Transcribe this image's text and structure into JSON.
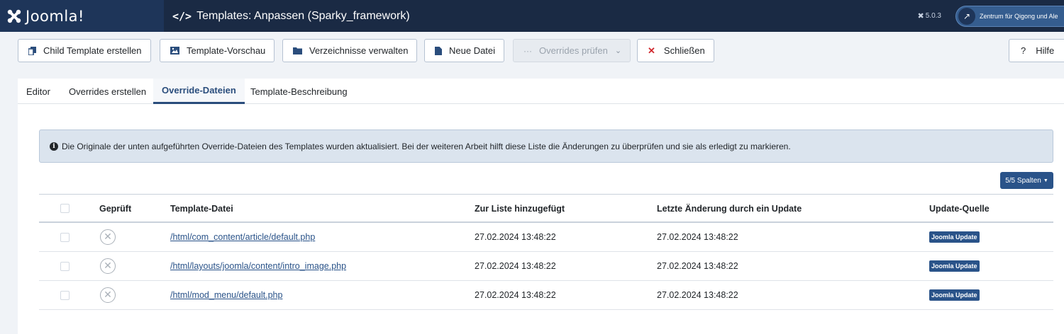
{
  "header": {
    "logo_text": "Joomla!",
    "title": "Templates: Anpassen (Sparky_framework)",
    "version": "5.0.3",
    "site_name": "Zentrum für Qigong und Ale"
  },
  "toolbar": {
    "child_template": "Child Template erstellen",
    "preview": "Template-Vorschau",
    "manage_folders": "Verzeichnisse verwalten",
    "new_file": "Neue Datei",
    "check_overrides": "Overrides prüfen",
    "close": "Schließen",
    "help": "Hilfe"
  },
  "tabs": [
    {
      "label": "Editor"
    },
    {
      "label": "Overrides erstellen"
    },
    {
      "label": "Override-Dateien"
    },
    {
      "label": "Template-Beschreibung"
    }
  ],
  "alert": {
    "text": "Die Originale der unten aufgeführten Override-Dateien des Templates wurden aktualisiert. Bei der weiteren Arbeit hilft diese Liste die Änderungen zu überprüfen und sie als erledigt zu markieren."
  },
  "columns_button": "5/5 Spalten",
  "table": {
    "headers": {
      "checked": "Geprüft",
      "file": "Template-Datei",
      "added": "Zur Liste hinzugefügt",
      "modified": "Letzte Änderung durch ein Update",
      "source": "Update-Quelle"
    },
    "rows": [
      {
        "file": "/html/com_content/article/default.php",
        "added": "27.02.2024 13:48:22",
        "modified": "27.02.2024 13:48:22",
        "source": "Joomla Update"
      },
      {
        "file": "/html/layouts/joomla/content/intro_image.php",
        "added": "27.02.2024 13:48:22",
        "modified": "27.02.2024 13:48:22",
        "source": "Joomla Update"
      },
      {
        "file": "/html/mod_menu/default.php",
        "added": "27.02.2024 13:48:22",
        "modified": "27.02.2024 13:48:22",
        "source": "Joomla Update"
      }
    ]
  },
  "colors": {
    "header_bg": "#1a2a44",
    "brand_bg": "#1e3559",
    "accent": "#2a5389",
    "danger": "#d0282e"
  }
}
